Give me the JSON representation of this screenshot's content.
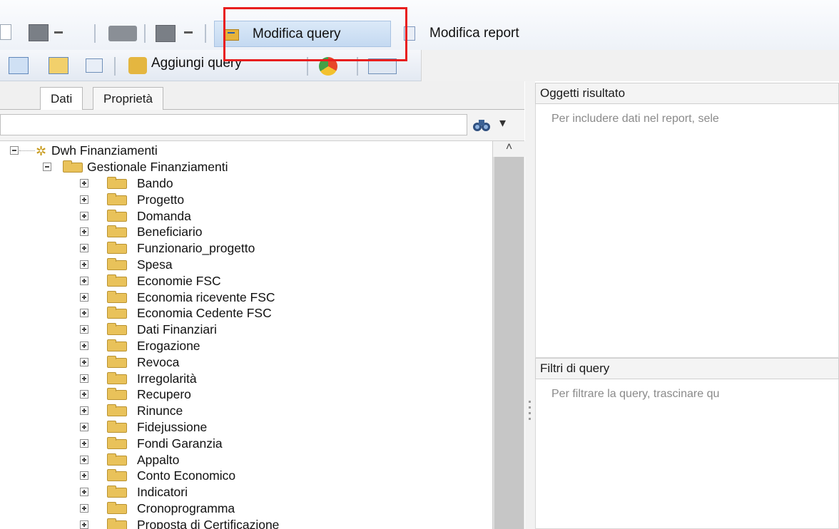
{
  "toolbar": {
    "modify_query_label": "Modifica query",
    "modify_report_label": "Modifica report",
    "add_query_label": "Aggiungi query"
  },
  "tabs": [
    {
      "label": "Dati",
      "active": true
    },
    {
      "label": "Proprietà",
      "active": false
    }
  ],
  "search": {
    "value": ""
  },
  "tree": {
    "root": {
      "label": "Dwh Finanziamenti",
      "expanded": true
    },
    "group": {
      "label": "Gestionale Finanziamenti",
      "expanded": true
    },
    "folders": [
      "Bando",
      "Progetto",
      "Domanda",
      "Beneficiario",
      "Funzionario_progetto",
      "Spesa",
      "Economie FSC",
      "Economia ricevente FSC",
      "Economia Cedente FSC",
      "Dati Finanziari",
      "Erogazione",
      "Revoca",
      "Irregolarità",
      "Recupero",
      "Rinunce",
      "Fidejussione",
      "Fondi Garanzia",
      "Appalto",
      "Conto Economico",
      "Indicatori",
      "Cronoprogramma",
      "Proposta di Certificazione"
    ]
  },
  "result_objects": {
    "title": "Oggetti risultato",
    "hint": "Per includere dati nel report, sele"
  },
  "query_filters": {
    "title": "Filtri di query",
    "hint": "Per filtrare la query, trascinare qu"
  },
  "colors": {
    "highlight_box": "#e81e1e",
    "selected_button": "#c4d9f1",
    "folder": "#e9c25a"
  }
}
